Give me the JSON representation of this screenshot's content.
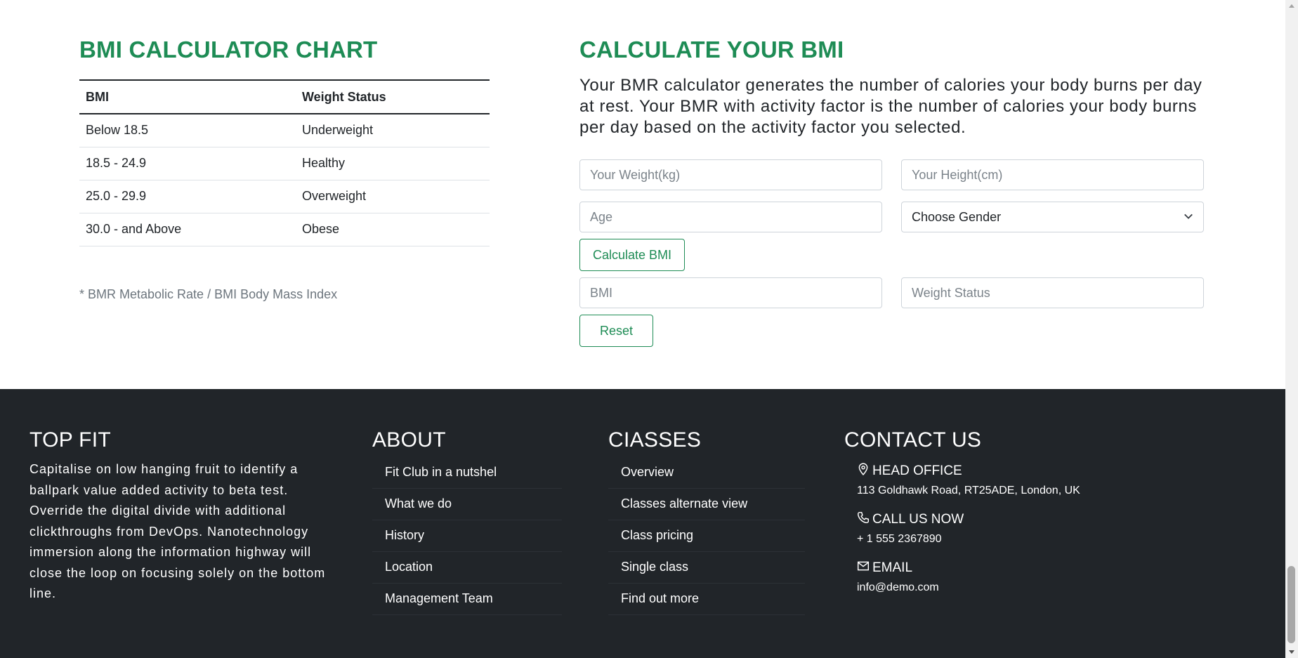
{
  "chart": {
    "title": "BMI CALCULATOR CHART",
    "headers": [
      "BMI",
      "Weight Status"
    ],
    "rows": [
      [
        "Below 18.5",
        "Underweight"
      ],
      [
        "18.5 - 24.9",
        "Healthy"
      ],
      [
        "25.0 - 29.9",
        "Overweight"
      ],
      [
        "30.0 - and Above",
        "Obese"
      ]
    ],
    "footnote": "* BMR Metabolic Rate / BMI Body Mass Index"
  },
  "calculator": {
    "title": "CALCULATE YOUR BMI",
    "description": "Your BMR calculator generates the number of calories your body burns per day at rest. Your BMR with activity factor is the number of calories your body burns per day based on the activity factor you selected.",
    "weight_placeholder": "Your Weight(kg)",
    "height_placeholder": "Your Height(cm)",
    "age_placeholder": "Age",
    "gender_selected": "Choose Gender",
    "calculate_label": "Calculate BMI",
    "bmi_placeholder": "BMI",
    "status_placeholder": "Weight Status",
    "reset_label": "Reset"
  },
  "footer": {
    "topfit": {
      "title": "TOP FIT",
      "text": "Capitalise on low hanging fruit to identify a ballpark value added activity to beta test. Override the digital divide with additional clickthroughs from DevOps. Nanotechnology immersion along the information highway will close the loop on focusing solely on the bottom line."
    },
    "about": {
      "title": "ABOUT",
      "links": [
        "Fit Club in a nutshel",
        "What we do",
        "History",
        "Location",
        "Management Team"
      ]
    },
    "classes": {
      "title": "CIASSES",
      "links": [
        "Overview",
        "Classes alternate view",
        "Class pricing",
        "Single class",
        "Find out more"
      ]
    },
    "contact": {
      "title": "CONTACT US",
      "office_title": "HEAD OFFICE",
      "office_value": "113 Goldhawk Road, RT25ADE, London, UK",
      "call_title": "CALL US NOW",
      "call_value": "+ 1 555 2367890",
      "email_title": "EMAIL",
      "email_value": "info@demo.com"
    }
  },
  "icons": {
    "office": "map-pin-icon",
    "call": "phone-icon",
    "email": "envelope-icon",
    "select": "chevron-down-icon"
  },
  "colors": {
    "accent": "#1e8c55",
    "footer_bg": "#212529"
  }
}
